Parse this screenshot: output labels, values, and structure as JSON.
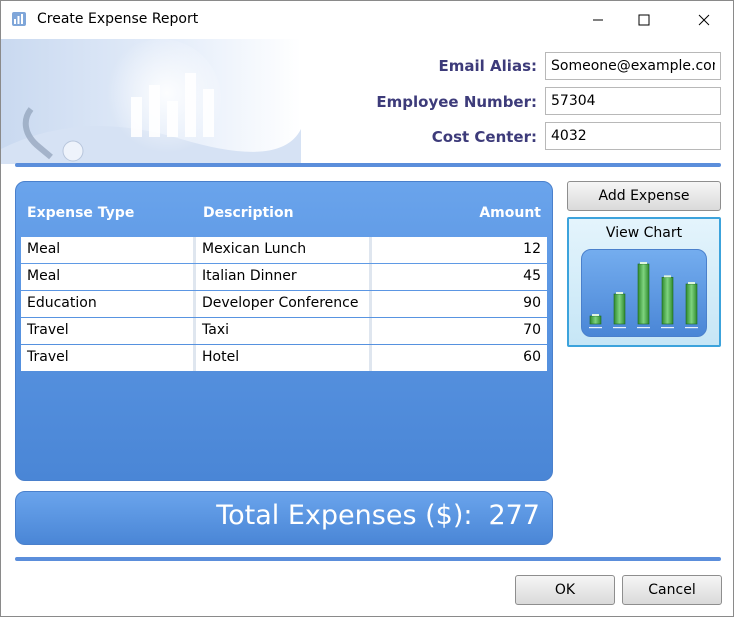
{
  "window": {
    "title": "Create Expense Report",
    "icons": [
      "app-icon",
      "minimize-icon",
      "maximize-icon",
      "close-icon"
    ]
  },
  "form": {
    "email_label": "Email Alias:",
    "email_value": "Someone@example.com",
    "employee_label": "Employee Number:",
    "employee_value": "57304",
    "cost_label": "Cost Center:",
    "cost_value": "4032"
  },
  "grid": {
    "headers": [
      "Expense Type",
      "Description",
      "Amount"
    ],
    "rows": [
      [
        "Meal",
        "Mexican Lunch",
        "12"
      ],
      [
        "Meal",
        "Italian Dinner",
        "45"
      ],
      [
        "Education",
        "Developer Conference",
        "90"
      ],
      [
        "Travel",
        "Taxi",
        "70"
      ],
      [
        "Travel",
        "Hotel",
        "60"
      ]
    ]
  },
  "total": {
    "label": "Total Expenses ($):",
    "value": "277"
  },
  "buttons": {
    "add_expense": "Add Expense",
    "view_chart": "View Chart",
    "ok": "OK",
    "cancel": "Cancel"
  },
  "mini_chart_values": [
    12,
    45,
    90,
    70,
    60
  ],
  "colors": {
    "accent": "#5b8edb",
    "label": "#3d3b7a",
    "bar": "#3fa03f"
  }
}
